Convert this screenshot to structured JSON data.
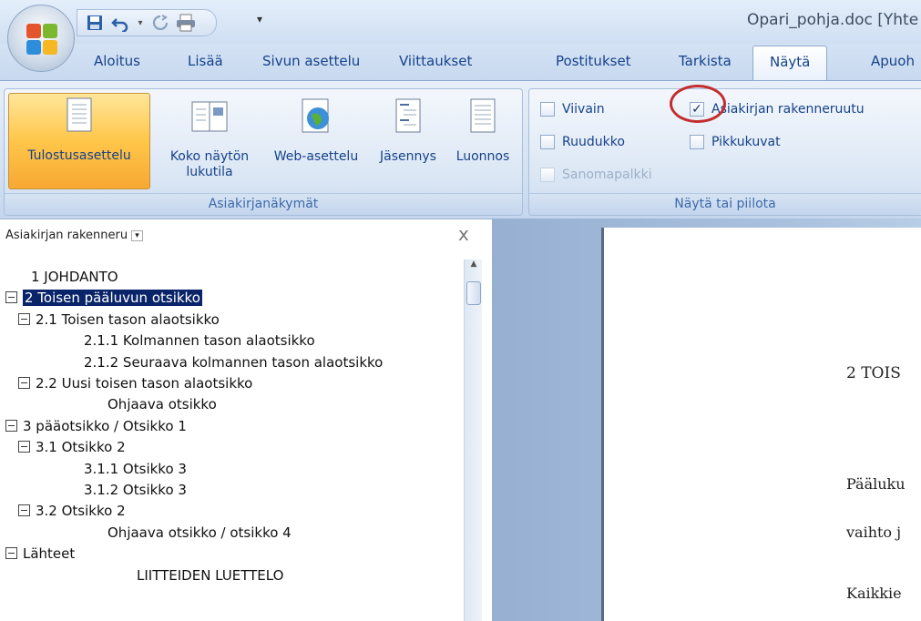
{
  "window": {
    "document_title": "Opari_pohja.doc [Yhte"
  },
  "tabs": [
    {
      "label": "Aloitus"
    },
    {
      "label": "Lisää"
    },
    {
      "label": "Sivun asettelu"
    },
    {
      "label": "Viittaukset"
    },
    {
      "label": "Postitukset"
    },
    {
      "label": "Tarkista"
    },
    {
      "label": "Näytä",
      "active": true
    },
    {
      "label": "Apuoh"
    }
  ],
  "ribbon": {
    "views_group": {
      "label": "Asiakirjanäkymät",
      "buttons": [
        {
          "label": "Tulostusasettelu",
          "active": true
        },
        {
          "label": "Koko näytön\nlukutila"
        },
        {
          "label": "Web-asettelu"
        },
        {
          "label": "Jäsennys"
        },
        {
          "label": "Luonnos"
        }
      ]
    },
    "show_group": {
      "label": "Näytä tai piilota",
      "options": [
        {
          "label": "Viivain",
          "checked": false
        },
        {
          "label": "Ruudukko",
          "checked": false
        },
        {
          "label": "Sanomapalkki",
          "checked": false,
          "disabled": true
        },
        {
          "label": "Asiakirjan rakenneruutu",
          "checked": true
        },
        {
          "label": "Pikkukuvat",
          "checked": false
        }
      ],
      "check_glyph": "✓"
    }
  },
  "document_map": {
    "dropdown_label": "Asiakirjan rakenneru",
    "close_glyph": "x",
    "items": [
      {
        "text": "1  JOHDANTO",
        "level": 0,
        "toggle": false
      },
      {
        "text": "2  Toisen pääluvun otsikko",
        "level": 0,
        "toggle": true,
        "selected": true
      },
      {
        "text": "2.1  Toisen tason alaotsikko",
        "level": 1,
        "toggle": true
      },
      {
        "text": "2.1.1  Kolmannen tason alaotsikko",
        "level": 2,
        "toggle": false
      },
      {
        "text": "2.1.2  Seuraava kolmannen tason alaotsikko",
        "level": 2,
        "toggle": false
      },
      {
        "text": "2.2  Uusi toisen tason alaotsikko",
        "level": 1,
        "toggle": true
      },
      {
        "text": "Ohjaava otsikko",
        "level": 3,
        "toggle": false
      },
      {
        "text": "3  pääotsikko / Otsikko 1",
        "level": 0,
        "toggle": true
      },
      {
        "text": "3.1  Otsikko 2",
        "level": 1,
        "toggle": true
      },
      {
        "text": "3.1.1  Otsikko 3",
        "level": 2,
        "toggle": false
      },
      {
        "text": "3.1.2  Otsikko 3",
        "level": 2,
        "toggle": false
      },
      {
        "text": "3.2  Otsikko 2",
        "level": 1,
        "toggle": true
      },
      {
        "text": "Ohjaava otsikko / otsikko 4",
        "level": 3,
        "toggle": false
      },
      {
        "text": "Lähteet",
        "level": 0,
        "toggle": true
      },
      {
        "text": "LIITTEIDEN LUETTELO",
        "level": 4,
        "toggle": false
      }
    ]
  },
  "document": {
    "heading": "2  TOIS",
    "line1": "Pääluku",
    "line2": "vaihto j",
    "line3": "Kaikkie"
  },
  "colors": {
    "accent_active": "#ffc64a",
    "selection": "#0a246a",
    "annotation_circle": "#c42d2d"
  }
}
